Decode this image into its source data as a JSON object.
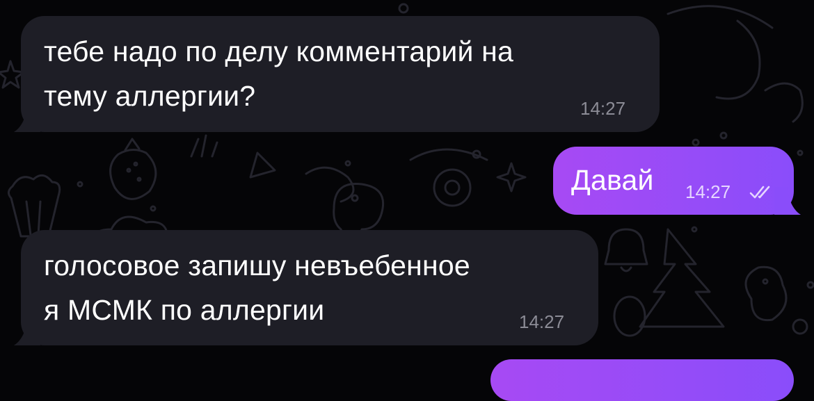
{
  "chat": {
    "messages": [
      {
        "direction": "incoming",
        "lines": [
          "тебе надо по делу комментарий на",
          "тему аллергии?"
        ],
        "time": "14:27"
      },
      {
        "direction": "outgoing",
        "lines": [
          "Давай"
        ],
        "time": "14:27",
        "status": "read",
        "status_icon": "double-check-icon"
      },
      {
        "direction": "incoming",
        "lines": [
          "голосовое запишу невъебенное",
          "я МСМК по аллергии"
        ],
        "time": "14:27"
      }
    ]
  },
  "colors": {
    "background": "#050507",
    "incoming_bubble": "#1e1e26",
    "outgoing_bubble_start": "#a74af4",
    "outgoing_bubble_end": "#8a4dfa",
    "doodle_stroke": "#24242d"
  },
  "icons": {
    "background_pattern": "doodle-pattern"
  }
}
